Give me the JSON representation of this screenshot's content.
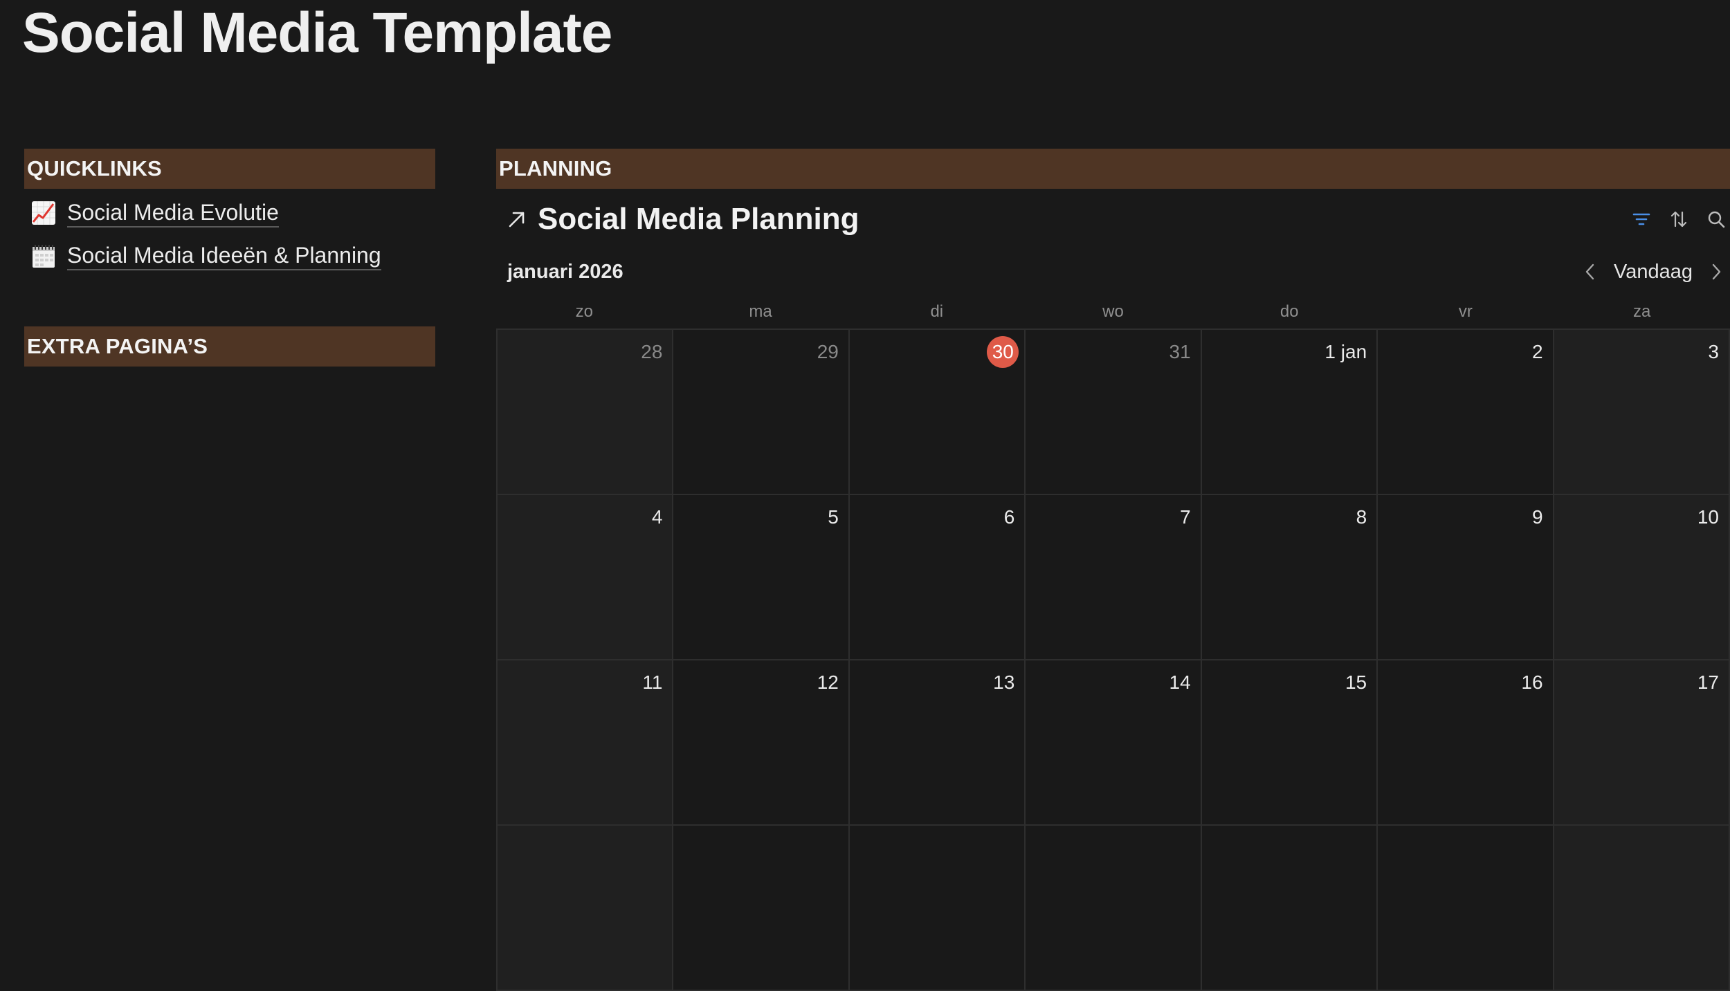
{
  "page": {
    "title": "Social Media Template"
  },
  "quicklinks": {
    "header": "QUICKLINKS",
    "items": [
      {
        "icon": "chart-increasing-icon",
        "label": "Social Media Evolutie"
      },
      {
        "icon": "spiral-calendar-icon",
        "label": "Social Media Ideeën & Planning"
      }
    ]
  },
  "extra": {
    "header": "EXTRA PAGINA’S"
  },
  "planning": {
    "header": "PLANNING",
    "database": {
      "title": "Social Media Planning",
      "link_icon": "arrow-up-right-icon",
      "tools": [
        "filter-icon",
        "sort-icon",
        "search-icon"
      ],
      "accent_color": "#4a8fe7"
    },
    "calendar": {
      "month": "januari 2026",
      "today_label": "Vandaag",
      "weekdays": [
        "zo",
        "ma",
        "di",
        "wo",
        "do",
        "vr",
        "za"
      ],
      "today_color": "#df5a48",
      "weeks": [
        [
          "28",
          "29",
          "30",
          "31",
          "1 jan",
          "2",
          "3"
        ],
        [
          "4",
          "5",
          "6",
          "7",
          "8",
          "9",
          "10"
        ],
        [
          "11",
          "12",
          "13",
          "14",
          "15",
          "16",
          "17"
        ]
      ]
    }
  },
  "colors": {
    "background": "#191919",
    "section_header_bg": "#4f3524"
  }
}
